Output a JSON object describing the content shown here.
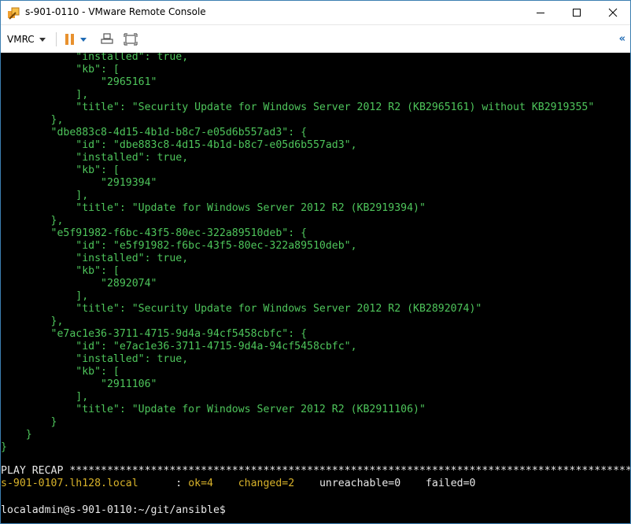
{
  "window": {
    "title": "s-901-0110 - VMware Remote Console"
  },
  "toolbar": {
    "menu_label": "VMRC",
    "collapse_glyph": "«"
  },
  "icons": {
    "app": "vmware-remote-console-icon",
    "minimize": "minimize-icon",
    "maximize": "maximize-icon",
    "close": "close-icon",
    "pause": "pause-icon",
    "send_keys": "send-ctrl-alt-del-icon",
    "fullscreen": "fullscreen-icon"
  },
  "colors": {
    "console_bg": "#000000",
    "json_green": "#4ec55b",
    "recap_yellow": "#d9b32a",
    "prompt_white": "#e8e8e8",
    "pause_orange": "#e8912e",
    "accent_blue": "#1e6ab4"
  },
  "console": {
    "lines": [
      "            \"installed\": true,",
      "            \"kb\": [",
      "                \"2965161\"",
      "            ],",
      "            \"title\": \"Security Update for Windows Server 2012 R2 (KB2965161) without KB2919355\"",
      "        },",
      "        \"dbe883c8-4d15-4b1d-b8c7-e05d6b557ad3\": {",
      "            \"id\": \"dbe883c8-4d15-4b1d-b8c7-e05d6b557ad3\",",
      "            \"installed\": true,",
      "            \"kb\": [",
      "                \"2919394\"",
      "            ],",
      "            \"title\": \"Update for Windows Server 2012 R2 (KB2919394)\"",
      "        },",
      "        \"e5f91982-f6bc-43f5-80ec-322a89510deb\": {",
      "            \"id\": \"e5f91982-f6bc-43f5-80ec-322a89510deb\",",
      "            \"installed\": true,",
      "            \"kb\": [",
      "                \"2892074\"",
      "            ],",
      "            \"title\": \"Security Update for Windows Server 2012 R2 (KB2892074)\"",
      "        },",
      "        \"e7ac1e36-3711-4715-9d4a-94cf5458cbfc\": {",
      "            \"id\": \"e7ac1e36-3711-4715-9d4a-94cf5458cbfc\",",
      "            \"installed\": true,",
      "            \"kb\": [",
      "                \"2911106\"",
      "            ],",
      "            \"title\": \"Update for Windows Server 2012 R2 (KB2911106)\"",
      "        }",
      "    }",
      "}"
    ],
    "recap_header": "PLAY RECAP *********************************************************************************************",
    "recap": {
      "host": "s-901-0107.lh128.local",
      "sep": "      : ",
      "ok": "ok=4",
      "gap1": "    ",
      "changed": "changed=2",
      "gap2": "    ",
      "unreachable": "unreachable=0",
      "gap3": "    ",
      "failed": "failed=0"
    },
    "prompt": "localadmin@s-901-0110:~/git/ansible$"
  }
}
